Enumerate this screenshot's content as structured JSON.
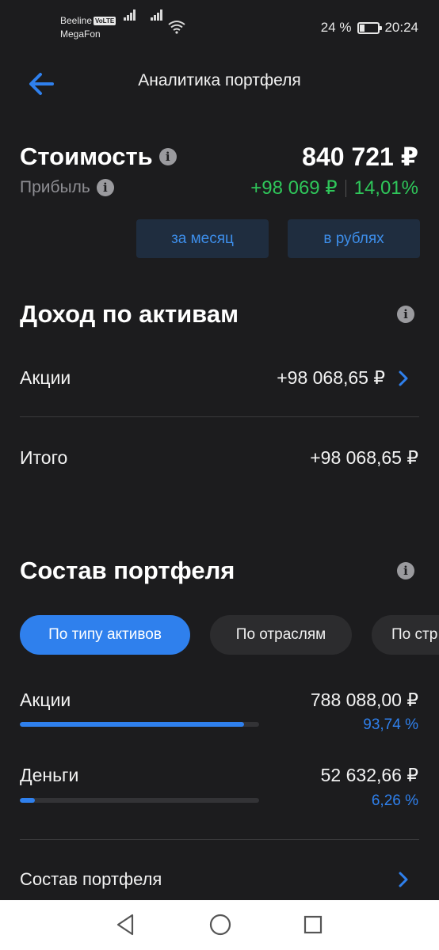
{
  "status_bar": {
    "carrier1": "Beeline",
    "volte": "VoLTE",
    "carrier2": "MegaFon",
    "battery": "24 %",
    "battery_level": 0.24,
    "time": "20:24"
  },
  "header": {
    "title": "Аналитика портфеля",
    "back_icon": "arrow-left-icon"
  },
  "summary": {
    "value_label": "Стоимость",
    "value": "840 721 ₽",
    "profit_label": "Прибыль",
    "profit_amount": "+98 069 ₽",
    "profit_percent": "14,01%",
    "info_glyph": "i"
  },
  "filters": {
    "period": "за месяц",
    "currency": "в рублях"
  },
  "income": {
    "title": "Доход по активам",
    "rows": [
      {
        "label": "Акции",
        "value": "+98 068,65 ₽"
      }
    ],
    "total_label": "Итого",
    "total_value": "+98 068,65 ₽"
  },
  "composition": {
    "title": "Состав портфеля",
    "chips": [
      "По типу активов",
      "По отраслям",
      "По стр"
    ],
    "items": [
      {
        "label": "Акции",
        "amount": "788 088,00 ₽",
        "percent": "93,74 %",
        "share": 0.9374
      },
      {
        "label": "Деньги",
        "amount": "52 632,66 ₽",
        "percent": "6,26 %",
        "share": 0.0626
      }
    ],
    "link_label": "Состав портфеля"
  },
  "colors": {
    "background": "#1c1c1e",
    "accent": "#2f80ed",
    "profit": "#2fc65a",
    "muted": "#8e8e93"
  }
}
